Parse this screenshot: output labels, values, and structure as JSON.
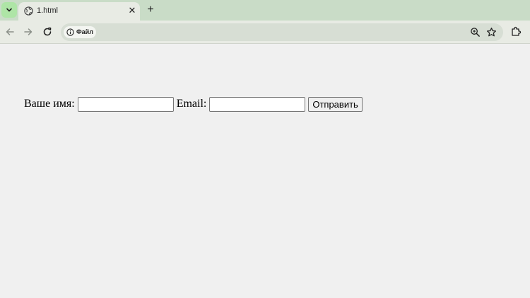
{
  "browser": {
    "tab": {
      "title": "1.html",
      "favicon": "globe-icon"
    },
    "omnibox": {
      "site_chip_label": "Файл"
    }
  },
  "form": {
    "name_label": "Ваше имя:",
    "name_value": "",
    "email_label": "Email:",
    "email_value": "",
    "submit_label": "Отправить"
  },
  "colors": {
    "tabstrip_bg": "#c9dcc7",
    "toolbar_bg": "#e8ebe4",
    "page_bg": "#f0f0f0"
  }
}
